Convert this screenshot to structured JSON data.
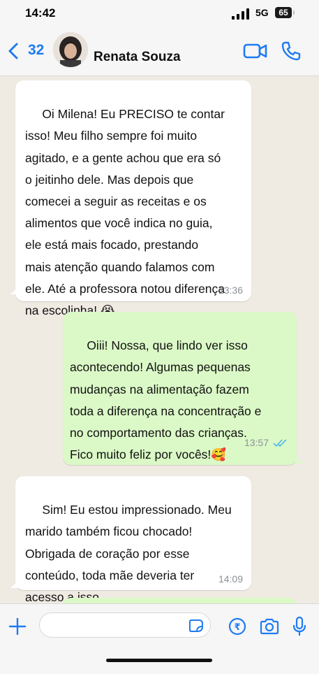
{
  "status_bar": {
    "time": "14:42",
    "network": "5G",
    "battery": "65"
  },
  "header": {
    "back_count": "32",
    "contact_name": "Renata Souza",
    "icons": [
      "chevron-left-icon",
      "video-call-icon",
      "voice-call-icon"
    ]
  },
  "messages": [
    {
      "direction": "incoming",
      "text": " Oi Milena! Eu PRECISO te contar\nisso! Meu filho sempre foi muito\nagitado, e a gente achou que era só\no jeitinho dele. Mas depois que\ncomecei a seguir as receitas e os\nalimentos que você indica no guia,\nele está mais focado, prestando\nmais atenção quando falamos com\nele. Até a professora notou diferença\nna escolinha! 😭",
      "time": "13:36"
    },
    {
      "direction": "outgoing",
      "text": " Oiii! Nossa, que lindo ver isso\nacontecendo! Algumas pequenas\nmudanças na alimentação fazem\ntoda a diferença na concentração e\nno comportamento das crianças.\nFico muito feliz por vocês!🥰",
      "time": "13:57",
      "status": "read"
    },
    {
      "direction": "incoming",
      "text": " Sim! Eu estou impressionado. Meu\nmarido também ficou chocado!\nObrigada de coração por esse\nconteúdo, toda mãe deveria ter\nacesso a isso.",
      "time": "14:09"
    }
  ],
  "composer": {
    "input_value": "",
    "icons": [
      "plus-icon",
      "sticker-icon",
      "payment-icon",
      "camera-icon",
      "microphone-icon"
    ]
  },
  "colors": {
    "accent": "#1f7bf2",
    "incoming_bubble": "#ffffff",
    "outgoing_bubble": "#dbf9c7",
    "chat_background": "#efeae2",
    "read_ticks": "#4fb6ec"
  }
}
